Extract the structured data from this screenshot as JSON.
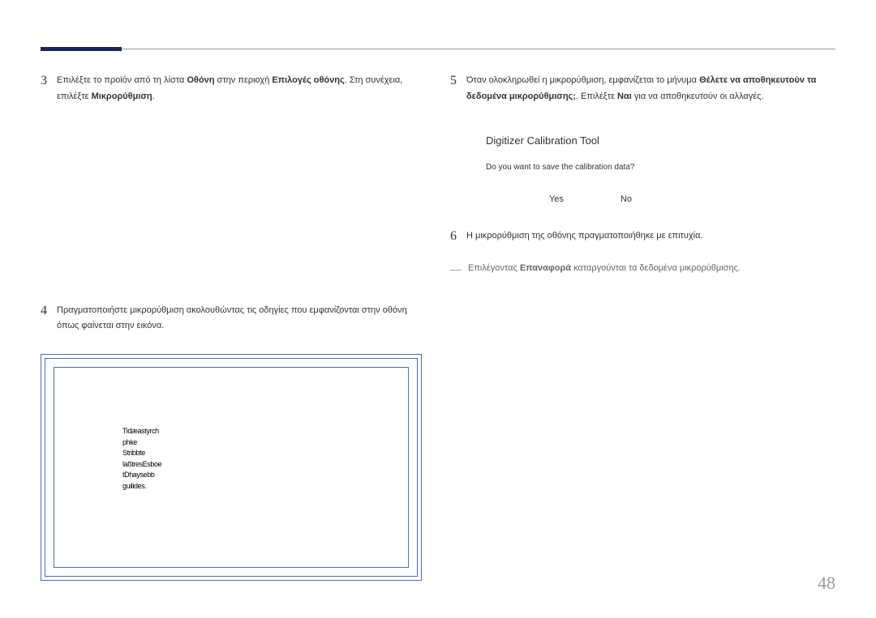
{
  "page_number": "48",
  "left": {
    "step3": {
      "num": "3",
      "text_before_othoni": "Επιλέξτε το προϊόν από τη λίστα ",
      "othoni": "Οθόνη",
      "text_mid1": " στην περιοχή ",
      "epiloges": "Επιλογές οθόνης",
      "text_mid2": ". Στη συνέχεια, επιλέξτε ",
      "mikro": "Μικρορύθμιση",
      "text_end": "."
    },
    "step4": {
      "num": "4",
      "text": "Πραγματοποιήστε μικρορύθμιση ακολουθώντας τις οδηγίες που εμφανίζονται στην οθόνη όπως φαίνεται στην εικόνα."
    },
    "calib_lines": [
      "Tidæastyrch",
      "phke",
      "Stribbte",
      "laßtresEsboe",
      "tDhaysebb",
      "guilides."
    ]
  },
  "right": {
    "step5": {
      "num": "5",
      "text_a": "Όταν ολοκληρωθεί η μικρορύθμιση, εμφανίζεται το μήνυμα ",
      "bold1": "Θέλετε να αποθηκευτούν τα δεδομένα μικρορύθμισης;",
      "text_b": ". Επιλέξτε ",
      "bold2": "Ναι",
      "text_c": " για να αποθηκευτούν οι αλλαγές."
    },
    "dialog": {
      "title": "Digitizer Calibration Tool",
      "message": "Do you want to save the calibration data?",
      "yes": "Yes",
      "no": "No"
    },
    "step6": {
      "num": "6",
      "text": "Η μικρορύθμιση της οθόνης πραγματοποιήθηκε με επιτυχία."
    },
    "note": {
      "dash": "―",
      "text_a": "Επιλέγοντας ",
      "bold": "Επαναφορά",
      "text_b": " καταργούνται τα δεδομένα μικρορύθμισης."
    }
  }
}
